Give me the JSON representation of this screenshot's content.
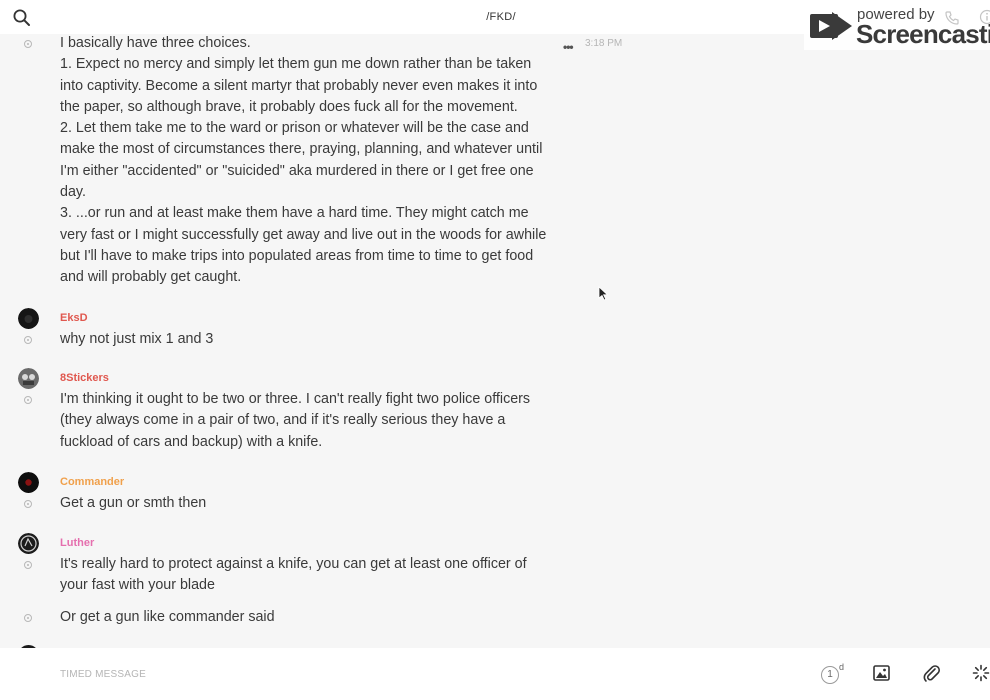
{
  "header": {
    "title": "/FKD/",
    "search_icon": "search-icon"
  },
  "watermark": {
    "powered_by": "powered by",
    "brand": "Screencastify"
  },
  "messages": [
    {
      "author": "",
      "time": "3:18 PM",
      "more_label": "•••",
      "lines": [
        "I basically have three choices.",
        "1. Expect no mercy and simply let them gun me down rather than be taken into captivity. Become a silent martyr that probably never even makes it into the paper, so although brave, it probably does fuck all for the movement.",
        "2. Let them take me to the ward or prison or whatever will be the case and make the most of circumstances there, praying, planning, and whatever until I'm either \"accidented\" or \"suicided\" aka murdered in there or I get free one day.",
        "3. ...or run and at least make them have a hard time. They might catch me very fast or I might successfully get away and live out in the woods for awhile but I'll have to make trips into populated areas from time to time to get food and will probably get caught."
      ]
    },
    {
      "author": "EksD",
      "author_color": "#e0584f",
      "text": "why not just mix 1 and 3"
    },
    {
      "author": "8Stickers",
      "author_color": "#e0584f",
      "text": "I'm thinking it ought to be two or three. I can't really fight two police officers (they always come in a pair of two, and if it's really serious they have a fuckload of cars and backup) with a knife."
    },
    {
      "author": "Commander",
      "author_color": "#f0a04b",
      "text": "Get a gun or smth then"
    },
    {
      "author": "Luther",
      "author_color": "#e56fae",
      "text": "It's really hard to protect against a knife, you can get at least one officer of your fast with your blade"
    },
    {
      "author": "",
      "text": "Or get a gun like commander said"
    }
  ],
  "composer": {
    "placeholder": "TIMED MESSAGE",
    "timer_value": "1",
    "timer_unit": "d"
  }
}
